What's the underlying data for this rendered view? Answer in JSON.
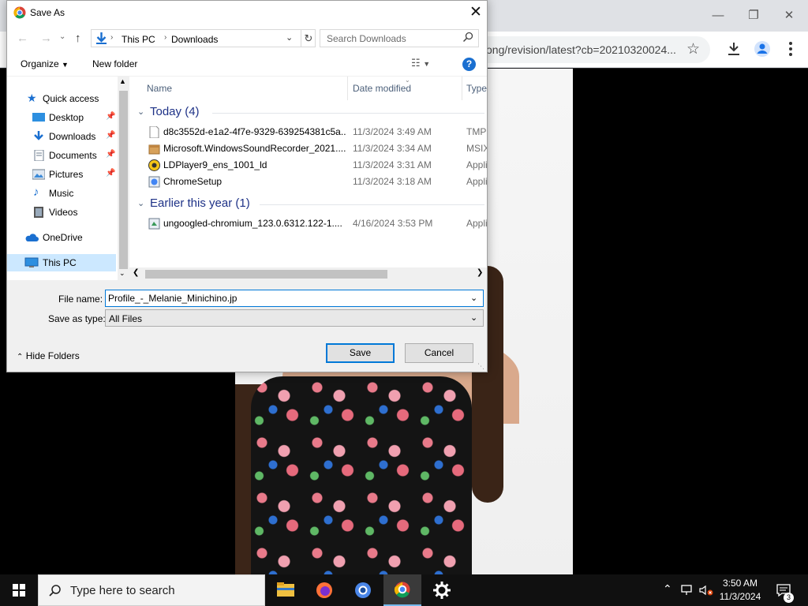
{
  "browser": {
    "url_fragment": "ong/revision/latest?cb=20210320024..."
  },
  "dialog": {
    "title": "Save As",
    "address": {
      "segments": [
        "This PC",
        "Downloads"
      ],
      "search_placeholder": "Search Downloads"
    },
    "commands": {
      "organize": "Organize",
      "new_folder": "New folder"
    },
    "nav_items": [
      {
        "label": "Quick access"
      },
      {
        "label": "Desktop"
      },
      {
        "label": "Downloads"
      },
      {
        "label": "Documents"
      },
      {
        "label": "Pictures"
      },
      {
        "label": "Music"
      },
      {
        "label": "Videos"
      },
      {
        "label": "OneDrive"
      },
      {
        "label": "This PC"
      }
    ],
    "columns": {
      "name": "Name",
      "date": "Date modified",
      "type": "Type"
    },
    "groups": [
      {
        "title": "Today (4)",
        "files": [
          {
            "name": "d8c3552d-e1a2-4f7e-9329-639254381c5a....",
            "date": "11/3/2024 3:49 AM",
            "type": "TMP"
          },
          {
            "name": "Microsoft.WindowsSoundRecorder_2021....",
            "date": "11/3/2024 3:34 AM",
            "type": "MSIX"
          },
          {
            "name": "LDPlayer9_ens_1001_ld",
            "date": "11/3/2024 3:31 AM",
            "type": "Appli"
          },
          {
            "name": "ChromeSetup",
            "date": "11/3/2024 3:18 AM",
            "type": "Appli"
          }
        ]
      },
      {
        "title": "Earlier this year (1)",
        "files": [
          {
            "name": "ungoogled-chromium_123.0.6312.122-1....",
            "date": "4/16/2024 3:53 PM",
            "type": "Appli"
          }
        ]
      }
    ],
    "form": {
      "filename_label": "File name:",
      "filename_value": "Profile_-_Melanie_Minichino.jp",
      "savetype_label": "Save as type:",
      "savetype_value": "All Files"
    },
    "buttons": {
      "hide_folders": "Hide Folders",
      "save": "Save",
      "cancel": "Cancel"
    }
  },
  "taskbar": {
    "search_text": "Type here to search",
    "time": "3:50 AM",
    "date": "11/3/2024",
    "notification_count": "3"
  },
  "colors": {
    "accent": "#0078d7",
    "group_heading": "#1e3287",
    "selected_nav": "#cce8ff"
  }
}
